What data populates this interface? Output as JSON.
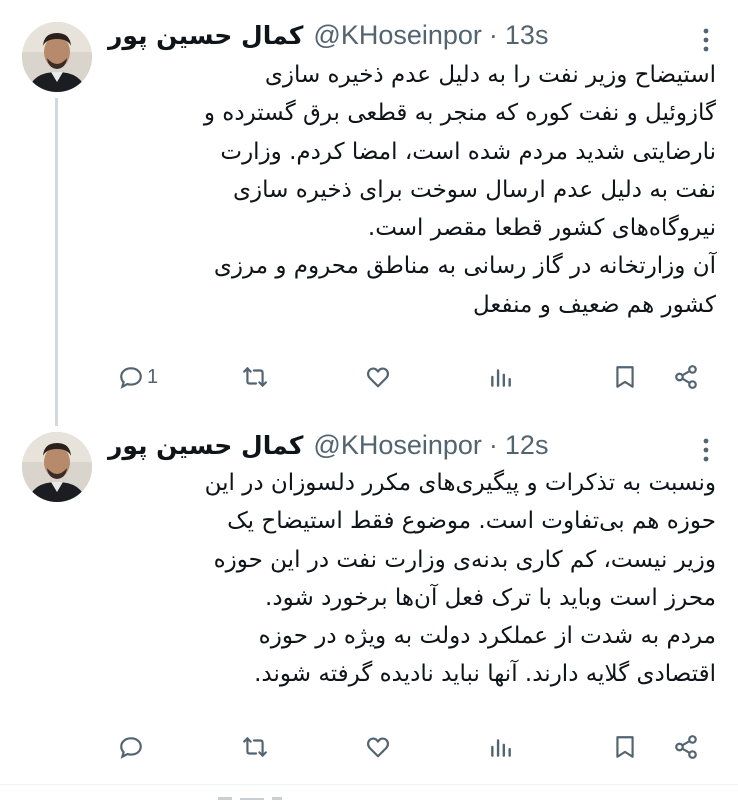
{
  "colors": {
    "text_primary": "#0f1419",
    "text_secondary": "#536471",
    "thread_line": "#cfd9de",
    "separator": "#eff3f4"
  },
  "tweets": [
    {
      "author": {
        "name": "کمال حسین پور",
        "handle": "@KHoseinpor",
        "dot": "·",
        "time": "13s",
        "avatar": "avatar-photo"
      },
      "lines": [
        "استیضاح وزیر نفت را به دلیل عدم ذخیره سازی",
        "گازوئیل و نفت کوره که منجر به قطعی برق گسترده و",
        "نارضایتی شدید مردم شده است، امضا کردم. وزارت",
        "نفت به دلیل عدم ارسال سوخت برای ذخیره سازی",
        "نیروگاه‌های کشور قطعا مقصر است.",
        "آن وزارتخانه در گاز رسانی به مناطق محروم و مرزی",
        "کشور هم ضعیف و منفعل"
      ],
      "reply_count": "1",
      "icons": [
        "reply-icon",
        "retweet-icon",
        "like-icon",
        "views-icon",
        "bookmark-icon",
        "share-icon",
        "more-icon"
      ]
    },
    {
      "author": {
        "name": "کمال حسین پور",
        "handle": "@KHoseinpor",
        "dot": "·",
        "time": "12s",
        "avatar": "avatar-photo"
      },
      "lines": [
        "ونسبت به تذکرات و پیگیری‌های مکرر دلسوزان در این",
        "حوزه هم بی‌تفاوت است. موضوع فقط استیضاح یک",
        "وزیر نیست، کم کاری بدنه‌ی وزارت نفت در این حوزه",
        "محرز است وباید با ترک فعل آن‌ها برخورد شود.",
        "مردم به شدت از عملکرد دولت به ویژه در حوزه",
        "اقتصادی گلایه دارند. آنها نباید نادیده گرفته شوند."
      ],
      "reply_count": "",
      "icons": [
        "reply-icon",
        "retweet-icon",
        "like-icon",
        "views-icon",
        "bookmark-icon",
        "share-icon",
        "more-icon"
      ]
    }
  ]
}
